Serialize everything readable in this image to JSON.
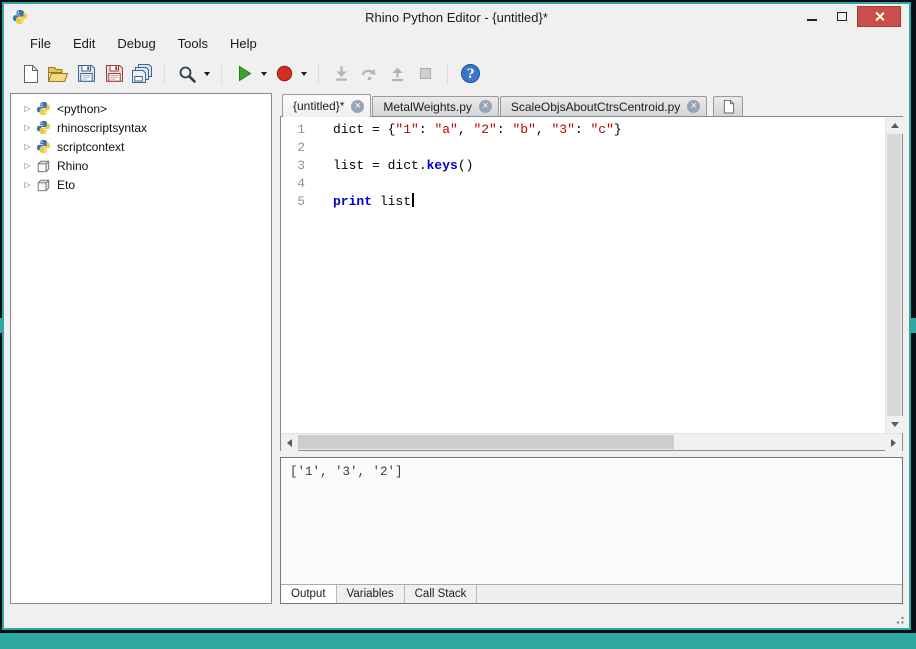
{
  "window": {
    "title": "Rhino Python Editor - {untitled}*",
    "controls": [
      {
        "name": "minimize"
      },
      {
        "name": "maximize"
      },
      {
        "name": "close"
      }
    ]
  },
  "menu": {
    "items": [
      "File",
      "Edit",
      "Debug",
      "Tools",
      "Help"
    ]
  },
  "toolbar": {
    "groups": [
      [
        {
          "name": "new-file"
        },
        {
          "name": "open-file"
        },
        {
          "name": "save-file"
        },
        {
          "name": "save-file-as"
        },
        {
          "name": "save-all"
        }
      ],
      [
        {
          "name": "search",
          "dropdown": true
        }
      ],
      [
        {
          "name": "run-script",
          "dropdown": true
        },
        {
          "name": "debug-run",
          "dropdown": true
        }
      ],
      [
        {
          "name": "step-into",
          "disabled": true
        },
        {
          "name": "step-over",
          "disabled": true
        },
        {
          "name": "step-out",
          "disabled": true
        },
        {
          "name": "stop",
          "disabled": true
        }
      ],
      [
        {
          "name": "help"
        }
      ]
    ]
  },
  "tree": {
    "items": [
      {
        "label": "<python>",
        "icon": "python"
      },
      {
        "label": "rhinoscriptsyntax",
        "icon": "python"
      },
      {
        "label": "scriptcontext",
        "icon": "python"
      },
      {
        "label": "Rhino",
        "icon": "module"
      },
      {
        "label": "Eto",
        "icon": "module"
      }
    ]
  },
  "editor": {
    "tabs": [
      {
        "label": "{untitled}*",
        "active": true,
        "closable": true
      },
      {
        "label": "MetalWeights.py",
        "active": false,
        "closable": true
      },
      {
        "label": "ScaleObjsAboutCtrsCentroid.py",
        "active": false,
        "closable": true
      }
    ],
    "lines": [
      {
        "num": "1",
        "segments": [
          [
            "p",
            "dict = {"
          ],
          [
            "s",
            "\"1\""
          ],
          [
            "p",
            ": "
          ],
          [
            "s",
            "\"a\""
          ],
          [
            "p",
            ", "
          ],
          [
            "s",
            "\"2\""
          ],
          [
            "p",
            ": "
          ],
          [
            "s",
            "\"b\""
          ],
          [
            "p",
            ", "
          ],
          [
            "s",
            "\"3\""
          ],
          [
            "p",
            ": "
          ],
          [
            "s",
            "\"c\""
          ],
          [
            "p",
            "}"
          ]
        ]
      },
      {
        "num": "2",
        "segments": []
      },
      {
        "num": "3",
        "segments": [
          [
            "p",
            "list = dict."
          ],
          [
            "k",
            "keys"
          ],
          [
            "p",
            "()"
          ]
        ]
      },
      {
        "num": "4",
        "segments": []
      },
      {
        "num": "5",
        "segments": [
          [
            "k",
            "print"
          ],
          [
            "p",
            " list"
          ]
        ],
        "caret": true
      }
    ]
  },
  "output": {
    "text": "['1', '3', '2']",
    "tabs": [
      {
        "label": "Output",
        "active": true
      },
      {
        "label": "Variables",
        "active": false
      },
      {
        "label": "Call Stack",
        "active": false
      }
    ]
  },
  "colors": {
    "accent_teal": "#2ea9a2",
    "close_button_red": "#c9504a",
    "syntax_string": "#c00000",
    "syntax_keyword": "#0000cd",
    "run_green": "#3aa42c",
    "record_red": "#d02f23",
    "python_blue": "#3874a8",
    "python_yellow": "#f0c93a"
  }
}
